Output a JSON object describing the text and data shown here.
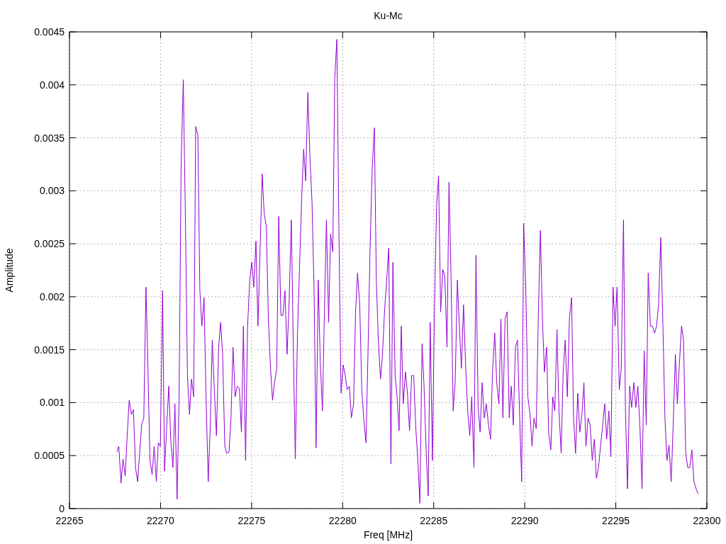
{
  "chart_data": {
    "type": "line",
    "grid": true,
    "title": "Ku-Mc",
    "xlabel": "Freq [MHz]",
    "ylabel": "Amplitude",
    "xlim": [
      22265,
      22300
    ],
    "ylim": [
      0,
      0.0045
    ],
    "xticks": [
      22265,
      22270,
      22275,
      22280,
      22285,
      22290,
      22295,
      22300
    ],
    "yticks": [
      {
        "value": 0,
        "label": "0"
      },
      {
        "value": 0.0005,
        "label": "0.0005"
      },
      {
        "value": 0.001,
        "label": "0.001"
      },
      {
        "value": 0.0015,
        "label": "0.0015"
      },
      {
        "value": 0.002,
        "label": "0.002"
      },
      {
        "value": 0.0025,
        "label": "0.0025"
      },
      {
        "value": 0.003,
        "label": "0.003"
      },
      {
        "value": 0.0035,
        "label": "0.0035"
      },
      {
        "value": 0.004,
        "label": "0.004"
      },
      {
        "value": 0.0045,
        "label": "0.0045"
      }
    ],
    "x": [
      22267.6,
      22267.71,
      22267.83,
      22267.94,
      22268.06,
      22268.17,
      22268.28,
      22268.4,
      22268.51,
      22268.63,
      22268.74,
      22268.85,
      22268.97,
      22269.08,
      22269.2,
      22269.31,
      22269.42,
      22269.54,
      22269.65,
      22269.77,
      22269.88,
      22269.99,
      22270.11,
      22270.22,
      22270.34,
      22270.45,
      22270.56,
      22270.68,
      22270.79,
      22270.91,
      22271.02,
      22271.13,
      22271.25,
      22271.36,
      22271.48,
      22271.59,
      22271.7,
      22271.82,
      22271.93,
      22272.05,
      22272.16,
      22272.27,
      22272.39,
      22272.5,
      22272.62,
      22272.73,
      22272.84,
      22272.96,
      22273.07,
      22273.19,
      22273.3,
      22273.41,
      22273.53,
      22273.64,
      22273.76,
      22273.87,
      22273.98,
      22274.1,
      22274.21,
      22274.33,
      22274.44,
      22274.55,
      22274.67,
      22274.78,
      22274.9,
      22275.01,
      22275.12,
      22275.24,
      22275.35,
      22275.47,
      22275.58,
      22275.69,
      22275.81,
      22275.92,
      22276.04,
      22276.15,
      22276.26,
      22276.38,
      22276.49,
      22276.61,
      22276.72,
      22276.83,
      22276.95,
      22277.06,
      22277.18,
      22277.29,
      22277.4,
      22277.52,
      22277.63,
      22277.75,
      22277.86,
      22277.97,
      22278.09,
      22278.2,
      22278.32,
      22278.43,
      22278.54,
      22278.66,
      22278.77,
      22278.89,
      22279.0,
      22279.11,
      22279.23,
      22279.34,
      22279.46,
      22279.57,
      22279.68,
      22279.8,
      22279.91,
      22280.03,
      22280.14,
      22280.25,
      22280.37,
      22280.48,
      22280.6,
      22280.71,
      22280.82,
      22280.94,
      22281.05,
      22281.17,
      22281.28,
      22281.39,
      22281.51,
      22281.62,
      22281.74,
      22281.85,
      22281.96,
      22282.08,
      22282.19,
      22282.31,
      22282.42,
      22282.53,
      22282.65,
      22282.76,
      22282.88,
      22282.99,
      22283.1,
      22283.22,
      22283.33,
      22283.45,
      22283.56,
      22283.67,
      22283.79,
      22283.9,
      22284.02,
      22284.13,
      22284.24,
      22284.36,
      22284.47,
      22284.59,
      22284.7,
      22284.81,
      22284.93,
      22285.04,
      22285.16,
      22285.27,
      22285.38,
      22285.5,
      22285.61,
      22285.73,
      22285.84,
      22285.95,
      22286.07,
      22286.18,
      22286.3,
      22286.41,
      22286.52,
      22286.64,
      22286.75,
      22286.87,
      22286.98,
      22287.09,
      22287.21,
      22287.32,
      22287.44,
      22287.55,
      22287.66,
      22287.78,
      22287.89,
      22288.01,
      22288.12,
      22288.23,
      22288.35,
      22288.46,
      22288.58,
      22288.69,
      22288.8,
      22288.92,
      22289.03,
      22289.15,
      22289.26,
      22289.37,
      22289.49,
      22289.6,
      22289.72,
      22289.83,
      22289.94,
      22290.06,
      22290.17,
      22290.29,
      22290.4,
      22290.51,
      22290.63,
      22290.74,
      22290.86,
      22290.97,
      22291.08,
      22291.2,
      22291.31,
      22291.43,
      22291.54,
      22291.65,
      22291.77,
      22291.88,
      22292.0,
      22292.11,
      22292.22,
      22292.34,
      22292.45,
      22292.57,
      22292.68,
      22292.79,
      22292.91,
      22293.02,
      22293.14,
      22293.25,
      22293.36,
      22293.48,
      22293.59,
      22293.71,
      22293.82,
      22293.93,
      22294.05,
      22294.16,
      22294.28,
      22294.39,
      22294.5,
      22294.62,
      22294.73,
      22294.85,
      22294.96,
      22295.07,
      22295.19,
      22295.3,
      22295.42,
      22295.53,
      22295.64,
      22295.76,
      22295.87,
      22295.99,
      22296.1,
      22296.21,
      22296.33,
      22296.44,
      22296.56,
      22296.67,
      22296.78,
      22296.9,
      22297.01,
      22297.13,
      22297.24,
      22297.35,
      22297.47,
      22297.58,
      22297.7,
      22297.81,
      22297.92,
      22298.04,
      22298.15,
      22298.27,
      22298.38,
      22298.49,
      22298.61,
      22298.72,
      22298.84,
      22298.95,
      22299.06,
      22299.18,
      22299.29,
      22299.41,
      22299.52
    ],
    "series": [
      {
        "values": [
          0.000535,
          0.000588,
          0.000241,
          0.000468,
          0.000307,
          0.000688,
          0.001022,
          0.000888,
          0.000935,
          0.000387,
          0.000254,
          0.000521,
          0.000802,
          0.000855,
          0.002091,
          0.001323,
          0.000454,
          0.000321,
          0.000588,
          0.000254,
          0.000621,
          0.000588,
          0.002057,
          0.000354,
          0.000788,
          0.001156,
          0.000655,
          0.000387,
          0.000989,
          9e-05,
          0.001055,
          0.00326,
          0.004048,
          0.002792,
          0.001256,
          0.000888,
          0.001222,
          0.001055,
          0.003607,
          0.003527,
          0.002057,
          0.001723,
          0.001991,
          0.001055,
          0.000254,
          0.000788,
          0.00159,
          0.001089,
          0.000688,
          0.001523,
          0.001757,
          0.001456,
          0.000588,
          0.000521,
          0.000535,
          0.000855,
          0.001523,
          0.001055,
          0.001156,
          0.001136,
          0.000721,
          0.001723,
          0.000454,
          0.001723,
          0.002158,
          0.002325,
          0.002091,
          0.002525,
          0.001723,
          0.002458,
          0.00316,
          0.002792,
          0.002659,
          0.00179,
          0.001323,
          0.001022,
          0.001189,
          0.001323,
          0.002759,
          0.001824,
          0.001824,
          0.002057,
          0.001456,
          0.001957,
          0.002725,
          0.001523,
          0.000468,
          0.001657,
          0.002258,
          0.002926,
          0.003393,
          0.003093,
          0.003928,
          0.003327,
          0.002892,
          0.002057,
          0.000574,
          0.002158,
          0.001389,
          0.000922,
          0.001857,
          0.002725,
          0.001757,
          0.002592,
          0.002425,
          0.004061,
          0.004429,
          0.002592,
          0.001089,
          0.001356,
          0.001256,
          0.001122,
          0.001156,
          0.000855,
          0.000989,
          0.001857,
          0.002224,
          0.001924,
          0.001122,
          0.000822,
          0.000621,
          0.001456,
          0.002492,
          0.003193,
          0.003594,
          0.002158,
          0.00159,
          0.001222,
          0.001456,
          0.00189,
          0.002158,
          0.002458,
          0.000421,
          0.002325,
          0.001256,
          0.001055,
          0.000735,
          0.001723,
          0.000989,
          0.001289,
          0.001089,
          0.000735,
          0.001256,
          0.001256,
          0.000755,
          0.000454,
          5e-05,
          0.001556,
          0.001156,
          0.000521,
          0.00012,
          0.001757,
          0.000454,
          0.001857,
          0.002859,
          0.00314,
          0.001857,
          0.002258,
          0.002191,
          0.001523,
          0.00308,
          0.002224,
          0.000922,
          0.001189,
          0.002158,
          0.001723,
          0.001323,
          0.001924,
          0.001356,
          0.000922,
          0.000688,
          0.001055,
          0.000387,
          0.002391,
          0.000955,
          0.000721,
          0.001189,
          0.000855,
          0.000989,
          0.000788,
          0.000655,
          0.001289,
          0.001657,
          0.001189,
          0.000989,
          0.00179,
          0.000855,
          0.00179,
          0.001857,
          0.000855,
          0.001156,
          0.000788,
          0.001523,
          0.00159,
          0.000855,
          0.000254,
          0.002692,
          0.002057,
          0.001055,
          0.000888,
          0.000588,
          0.000855,
          0.000755,
          0.00179,
          0.002625,
          0.00179,
          0.001289,
          0.001523,
          0.000721,
          0.000554,
          0.001055,
          0.000922,
          0.00169,
          0.000922,
          0.000521,
          0.001289,
          0.00159,
          0.001055,
          0.00179,
          0.001991,
          0.000855,
          0.000521,
          0.001089,
          0.000721,
          0.000888,
          0.001189,
          0.000588,
          0.000855,
          0.000788,
          0.000454,
          0.000655,
          0.000287,
          0.000387,
          0.000588,
          0.000788,
          0.000989,
          0.000655,
          0.000922,
          0.000488,
          0.002091,
          0.001723,
          0.002091,
          0.001122,
          0.001323,
          0.002725,
          0.000922,
          0.000187,
          0.001156,
          0.000955,
          0.001189,
          0.000955,
          0.001156,
          0.000755,
          0.000187,
          0.00149,
          0.000788,
          0.002224,
          0.001723,
          0.001723,
          0.001657,
          0.001723,
          0.001924,
          0.002558,
          0.00179,
          0.000855,
          0.000454,
          0.000601,
          0.000254,
          0.000788,
          0.001456,
          0.000989,
          0.001356,
          0.001723,
          0.00159,
          0.000521,
          0.000387,
          0.000387,
          0.000554,
          0.000254,
          0.000187,
          0.00014
        ]
      }
    ]
  }
}
